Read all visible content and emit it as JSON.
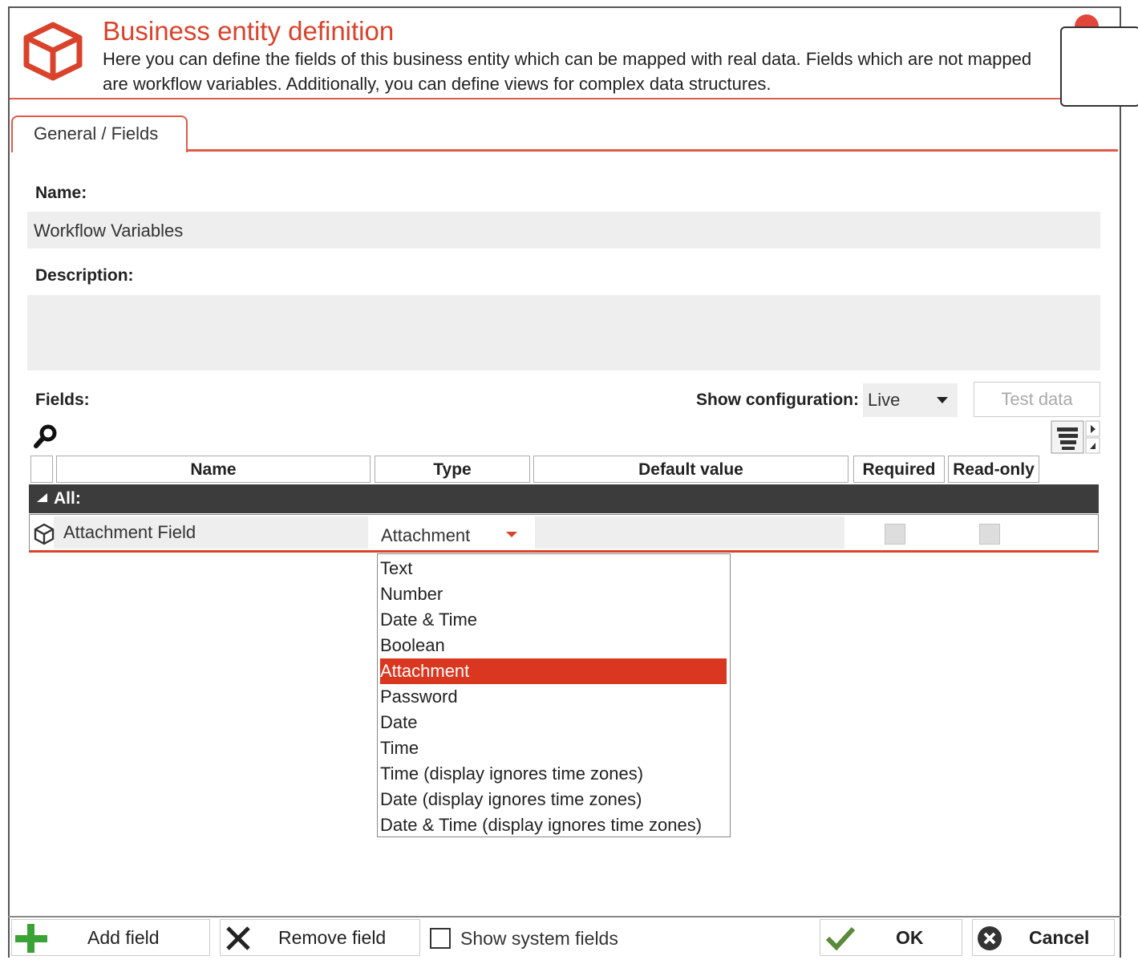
{
  "dialog": {
    "title": "Business entity definition",
    "description": "Here you can define the fields of this business entity which can be mapped with real data. Fields which are not mapped are workflow variables. Additionally, you can define views for complex data structures."
  },
  "tabs": [
    {
      "label": "General / Fields",
      "active": true
    }
  ],
  "form": {
    "name_label": "Name:",
    "name_value": "Workflow Variables",
    "description_label": "Description:",
    "description_value": "",
    "fields_label": "Fields:",
    "show_config_label": "Show configuration:",
    "show_config_value": "Live",
    "test_data_label": "Test data"
  },
  "table": {
    "columns": [
      "Name",
      "Type",
      "Default value",
      "Required",
      "Read-only"
    ],
    "group_label": "All:",
    "rows": [
      {
        "name": "Attachment Field",
        "type": "Attachment",
        "default_value": "",
        "required": false,
        "read_only": false
      }
    ]
  },
  "type_dropdown": {
    "options": [
      "Text",
      "Number",
      "Date & Time",
      "Boolean",
      "Attachment",
      "Password",
      "Date",
      "Time",
      "Time (display ignores time zones)",
      "Date (display ignores time zones)",
      "Date & Time (display ignores time zones)"
    ],
    "selected": "Attachment"
  },
  "footer": {
    "add_field": "Add field",
    "remove_field": "Remove field",
    "show_system_fields": "Show system fields",
    "show_system_fields_checked": false,
    "ok": "OK",
    "cancel": "Cancel"
  },
  "colors": {
    "accent": "#d9432c",
    "selected_item": "#d9371f",
    "group_header": "#3c3c3c",
    "field_background": "#eeeeee",
    "add_icon": "#3aa335",
    "ok_icon": "#5a8a3a"
  },
  "icons": [
    "business-entity-cube-icon",
    "close-icon",
    "search-icon",
    "column-chooser-icon",
    "collapse-triangle-icon",
    "field-cube-icon",
    "dropdown-arrow-icon",
    "add-icon",
    "remove-x-icon",
    "check-icon",
    "cancel-icon"
  ]
}
